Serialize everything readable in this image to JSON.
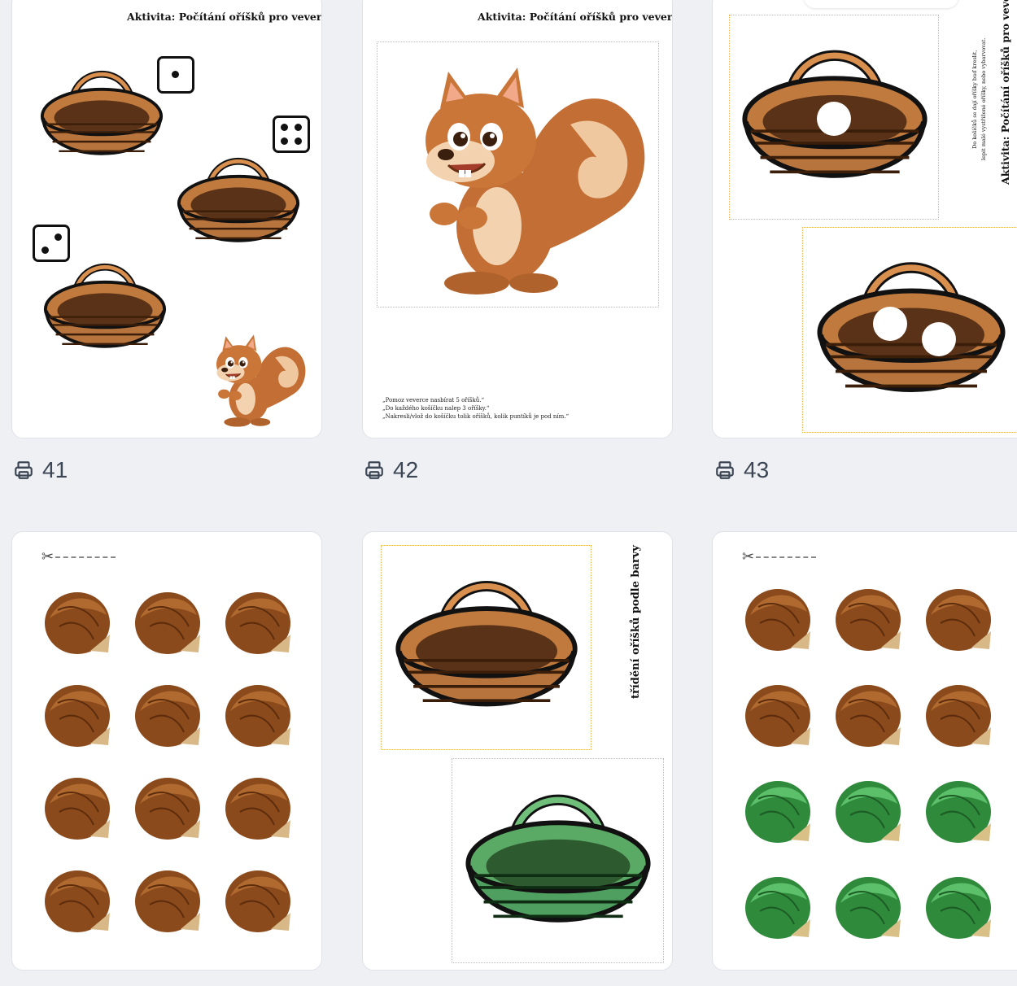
{
  "cards": [
    {
      "title": "Aktivita: Počítání oříšků pro veverku",
      "count": "41"
    },
    {
      "title": "Aktivita: Počítání oříšků pro veverku",
      "count": "42",
      "instructions": [
        "„Pomoz veverce nasbírat 5 oříšků.“",
        "„Do každého košíčku nalep 3 oříšky.“",
        "„Nakresli/vlož do košíčku tolik oříšků, kolik puntíků je pod ním.“"
      ]
    },
    {
      "title": "Aktivita: Počítání oříšků pro veverku",
      "count": "43",
      "note1": "Do košíčků se dají oříšky buď kreslit,",
      "note2": "lepit malé vystřižené oříšky, nebo vybarvovat."
    },
    {
      "type": "nuts-brown"
    },
    {
      "title": "třídění oříšků podle barvy"
    },
    {
      "type": "nuts-mixed"
    }
  ],
  "colors": {
    "basket_brown": "#b8743d",
    "basket_green": "#4fa060",
    "nut_brown": "#8a4a1c",
    "nut_green": "#2f8a3c",
    "dotted_border": "#f2b14a"
  },
  "icons": {
    "print": "printer-icon",
    "cut": "scissors-icon"
  }
}
